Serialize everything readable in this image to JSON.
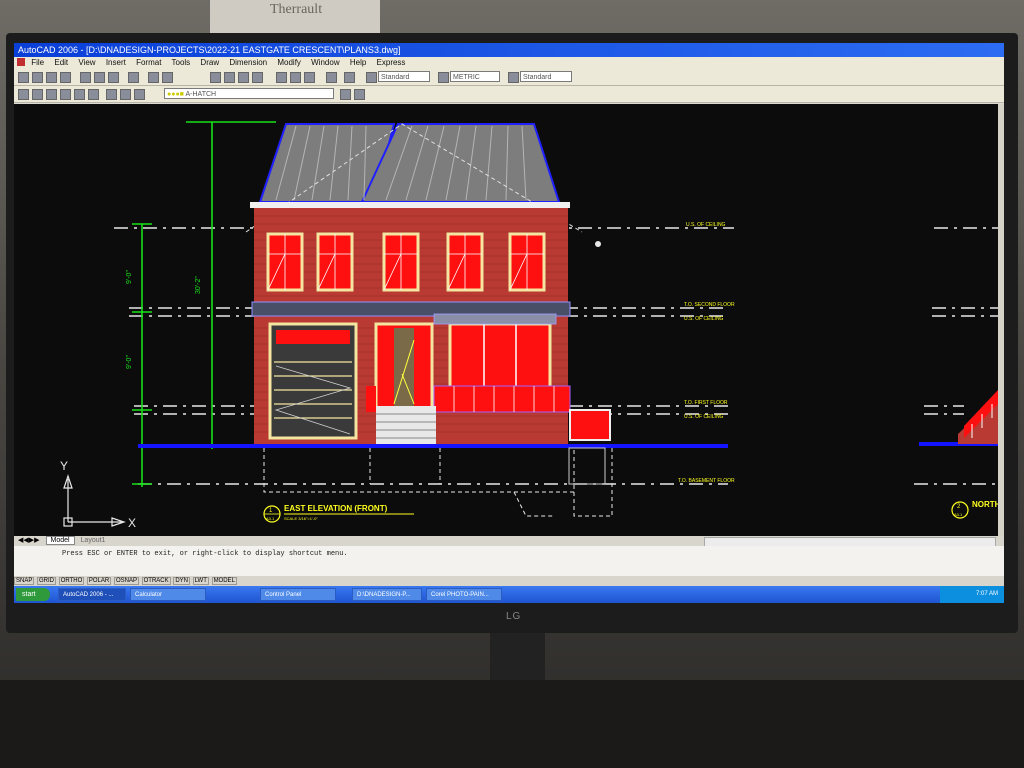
{
  "photo": {
    "background_note_text": "Therrault",
    "monitor_logo": "LG"
  },
  "window": {
    "title": "AutoCAD 2006 - [D:\\DNADESIGN-PROJECTS\\2022-21 EASTGATE CRESCENT\\PLANS3.dwg]"
  },
  "menu": {
    "items": [
      "File",
      "Edit",
      "View",
      "Insert",
      "Format",
      "Tools",
      "Draw",
      "Dimension",
      "Modify",
      "Window",
      "Help",
      "Express"
    ]
  },
  "toolbar": {
    "text_style": "Standard",
    "dim_style": "METRIC",
    "table_style": "Standard",
    "layer": "A-HATCH"
  },
  "drawing": {
    "labels": {
      "uso_ceiling_top": "U.S. OF CEILING",
      "to_second_floor": "T.O. SECOND FLOOR",
      "uso_ceiling_mid": "U.S. OF CEILING",
      "to_first_floor": "T.O. FIRST FLOOR",
      "uso_ceiling_low": "U.S. OF CEILING",
      "to_basement_floor": "T.O. BASEMENT FLOOR"
    },
    "title": "EAST ELEVATION (FRONT)",
    "title_scale": "SCALE 3/16\"=1'-0\"",
    "title_number": "1",
    "title_ref": "A3.1",
    "north_title": "NORTH",
    "north_number": "2",
    "north_ref": "A3.1",
    "dim_overall": "30'-2\"",
    "dim_upper": "9'-0\"",
    "dim_lower": "9'-0\"",
    "ucs_x": "X",
    "ucs_y": "Y"
  },
  "tabs": {
    "model": "Model",
    "layout": "Layout1"
  },
  "command": {
    "line": "Press ESC or ENTER to exit, or right-click to display shortcut menu."
  },
  "status": {
    "toggles": [
      "SNAP",
      "GRID",
      "ORTHO",
      "POLAR",
      "OSNAP",
      "OTRACK",
      "DYN",
      "LWT",
      "MODEL"
    ]
  },
  "taskbar": {
    "start": "start",
    "buttons": [
      "AutoCAD 2006 - ...",
      "Calculator",
      "Control Panel",
      "D:\\DNADESIGN-P...",
      "Corel PHOTO-PAIN..."
    ],
    "clock": "7:07 AM"
  },
  "colors": {
    "brick": "#b83a32",
    "window_red": "#ff1010",
    "roof": "#7d7d7d",
    "ground_line": "#1414ff",
    "dimension": "#18e018",
    "label_yellow": "#ffff20"
  }
}
